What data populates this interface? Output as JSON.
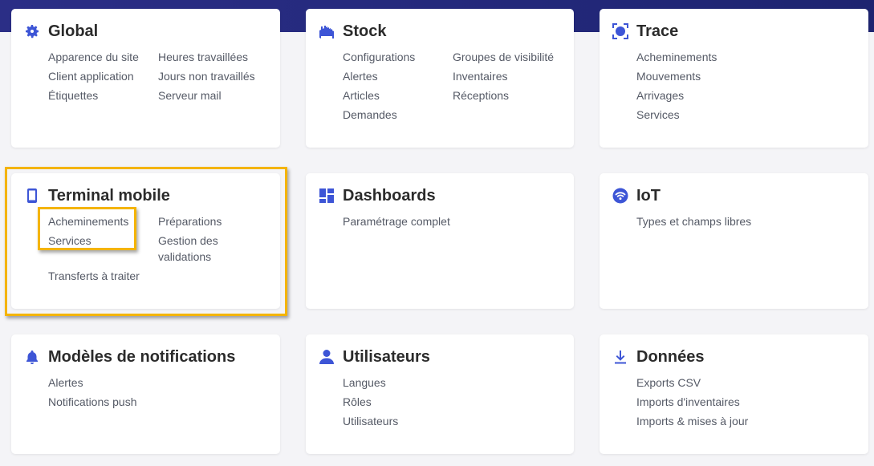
{
  "cards": {
    "global": {
      "title": "Global",
      "icon": "gear-icon",
      "col1": [
        "Apparence du site",
        "Client application",
        "Étiquettes"
      ],
      "col2": [
        "Heures travaillées",
        "Jours non travaillés",
        "Serveur mail"
      ]
    },
    "stock": {
      "title": "Stock",
      "icon": "warehouse-icon",
      "col1": [
        "Configurations",
        "Alertes",
        "Articles",
        "Demandes"
      ],
      "col2": [
        "Groupes de visibilité",
        "Inventaires",
        "Réceptions"
      ]
    },
    "trace": {
      "title": "Trace",
      "icon": "scan-icon",
      "col1": [
        "Acheminements",
        "Mouvements",
        "Arrivages",
        "Services"
      ]
    },
    "terminal": {
      "title": "Terminal mobile",
      "icon": "mobile-icon",
      "col1": [
        "Acheminements",
        "Services",
        "Transferts à traiter"
      ],
      "col2": [
        "Préparations",
        "Gestion des validations"
      ]
    },
    "dashboards": {
      "title": "Dashboards",
      "icon": "dashboard-icon",
      "col1": [
        "Paramétrage complet"
      ]
    },
    "iot": {
      "title": "IoT",
      "icon": "wifi-icon",
      "col1": [
        "Types et champs libres"
      ]
    },
    "notifications": {
      "title": "Modèles de notifications",
      "icon": "bell-icon",
      "col1": [
        "Alertes",
        "Notifications push"
      ]
    },
    "utilisateurs": {
      "title": "Utilisateurs",
      "icon": "user-icon",
      "col1": [
        "Langues",
        "Rôles",
        "Utilisateurs"
      ]
    },
    "donnees": {
      "title": "Données",
      "icon": "download-icon",
      "col1": [
        "Exports CSV",
        "Imports d'inventaires",
        "Imports & mises à jour"
      ]
    }
  },
  "colors": {
    "accent": "#3d55d6",
    "highlight": "#f4b400",
    "topbar": "#2b2e86"
  }
}
